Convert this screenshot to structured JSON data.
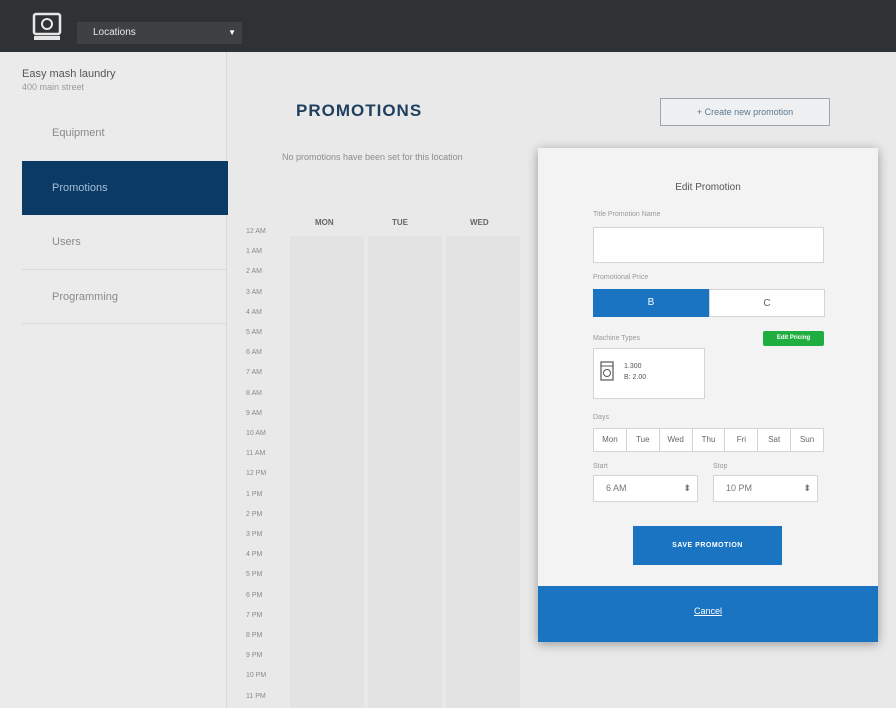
{
  "header": {
    "location_label": "Locations"
  },
  "sidebar": {
    "business_name": "Easy mash laundry",
    "business_address": "400 main street",
    "items": [
      {
        "label": "Equipment"
      },
      {
        "label": "Promotions"
      },
      {
        "label": "Users"
      },
      {
        "label": "Programming"
      }
    ]
  },
  "main": {
    "title": "PROMOTIONS",
    "create_button": "+ Create new promotion",
    "notice": "No promotions have been set for this location",
    "calendar": {
      "days": [
        "MON",
        "TUE",
        "WED"
      ],
      "times": [
        "12 AM",
        "1 AM",
        "2 AM",
        "3 AM",
        "4 AM",
        "5 AM",
        "6 AM",
        "7 AM",
        "8 AM",
        "9 AM",
        "10 AM",
        "11 AM",
        "12 PM",
        "1 PM",
        "2 PM",
        "3 PM",
        "4 PM",
        "5 PM",
        "6 PM",
        "7 PM",
        "8 PM",
        "9 PM",
        "10 PM",
        "11 PM"
      ]
    }
  },
  "modal": {
    "title": "Edit Promotion",
    "name_label": "Title Promotion Name",
    "promotion_type_label": "Promotional Price",
    "types": [
      "B",
      "C"
    ],
    "machine_types_label": "Machine Types",
    "edit_pricing": "Edit Pricing",
    "machine_line1": "1.300",
    "machine_line2": "B: 2.00",
    "days_label": "Days",
    "days": [
      "Mon",
      "Tue",
      "Wed",
      "Thu",
      "Fri",
      "Sat",
      "Sun"
    ],
    "start_label": "Start",
    "stop_label": "Stop",
    "start_value": "6 AM",
    "stop_value": "10 PM",
    "save_button": "SAVE PROMOTION",
    "cancel": "Cancel"
  },
  "colors": {
    "accent": "#1a74c2",
    "nav_active": "#0b3a66",
    "success": "#1fae3f",
    "topbar": "#2f3235"
  }
}
